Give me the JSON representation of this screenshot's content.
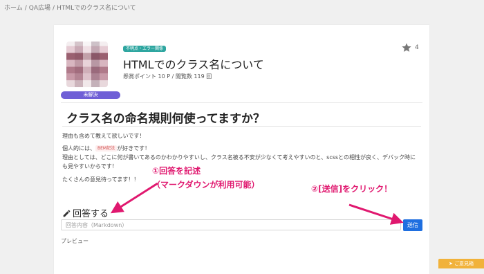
{
  "breadcrumb": {
    "home": "ホーム",
    "qa": "QA広場",
    "current": "HTMLでのクラス名について",
    "separator": "/"
  },
  "question": {
    "status": "未解決",
    "tag": "不明点・エラー関係",
    "title": "HTMLでのクラス名について",
    "meta": "懸賞ポイント 10 P / 閲覧数 119 回",
    "star_count": "4"
  },
  "body": {
    "heading": "クラス名の命名規則何使ってますか？",
    "p1": "理由も含めて教えて欲しいです！",
    "p2_prefix": "個人的には、",
    "p2_tag": "BEM記法",
    "p2_suffix": "が好きです！",
    "p3": "理由としては、どこに何が書いてあるのかわかりやすいし、クラス名被る不安が少なくて考えやすいのと、scssとの相性が良く、デバック時にも見やすいからです！",
    "p3a": "理由としては、どこに何が書いてあるのかわかりやすいし、クラス名被る不安が少なくて考えやすいのと、scssとの相性が良く、デバック時に",
    "p3b": "も見やすいからです！",
    "p4": "たくさんの意見待ってます！！"
  },
  "answer": {
    "heading": "回答する",
    "placeholder": "回答内容（Markdown）",
    "send_label": "送信",
    "preview_label": "プレビュー"
  },
  "annotations": {
    "step1": "①回答を記述",
    "step1_note": "（マークダウンが利用可能）",
    "step2": "②[送信]をクリック！"
  },
  "feedback": {
    "label": "ご意見箱"
  },
  "colors": {
    "annotation": "#e0186f",
    "status": "#6f5fd6",
    "tag": "#2ea6a0",
    "send": "#1f6fe0",
    "feedback": "#f1b23a"
  },
  "icons": [
    "star-icon",
    "pencil-icon",
    "send-icon"
  ]
}
